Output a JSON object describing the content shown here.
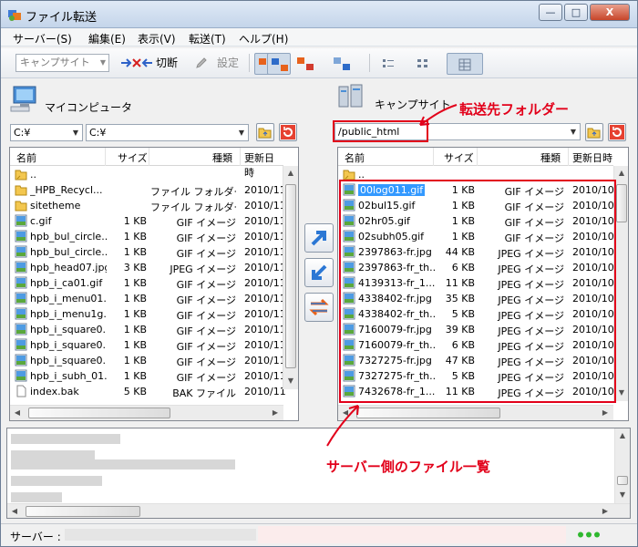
{
  "window": {
    "title": "ファイル転送"
  },
  "title_buttons": {
    "minimize": "—",
    "maximize": "□",
    "close": "X"
  },
  "menu": [
    "サーバー(S)",
    "編集(E)",
    "表示(V)",
    "転送(T)",
    "ヘルプ(H)"
  ],
  "toolbar": {
    "site_select": "キャンプサイト",
    "disconnect_label": "切断",
    "settings_label": "設定",
    "mode_icons": [
      "upload-ascii-icon",
      "upload-binary-icon",
      "download-ascii-icon",
      "download-binary-icon",
      "view-list-icon",
      "view-small-icons-icon",
      "view-details-icon"
    ]
  },
  "left_pane": {
    "title": "マイコンピュータ",
    "drive": "C:¥",
    "path": "C:¥",
    "columns": [
      "名前",
      "サイズ",
      "種類",
      "更新日時"
    ],
    "rows": [
      {
        "icon": "folder-up-icon",
        "name": "..",
        "size": "",
        "type": "",
        "date": ""
      },
      {
        "icon": "folder-icon",
        "name": "_HPB_Recycl...",
        "size": "",
        "type": "ファイル フォルダー",
        "date": "2010/11"
      },
      {
        "icon": "folder-icon",
        "name": "sitetheme",
        "size": "",
        "type": "ファイル フォルダー",
        "date": "2010/11"
      },
      {
        "icon": "image-icon",
        "name": "c.gif",
        "size": "1 KB",
        "type": "GIF イメージ",
        "date": "2010/11"
      },
      {
        "icon": "image-icon",
        "name": "hpb_bul_circle...",
        "size": "1 KB",
        "type": "GIF イメージ",
        "date": "2010/11"
      },
      {
        "icon": "image-icon",
        "name": "hpb_bul_circle...",
        "size": "1 KB",
        "type": "GIF イメージ",
        "date": "2010/11"
      },
      {
        "icon": "image-icon",
        "name": "hpb_head07.jpg",
        "size": "3 KB",
        "type": "JPEG イメージ",
        "date": "2010/11"
      },
      {
        "icon": "image-icon",
        "name": "hpb_i_ca01.gif",
        "size": "1 KB",
        "type": "GIF イメージ",
        "date": "2010/11"
      },
      {
        "icon": "image-icon",
        "name": "hpb_i_menu01...",
        "size": "1 KB",
        "type": "GIF イメージ",
        "date": "2010/11"
      },
      {
        "icon": "image-icon",
        "name": "hpb_i_menu1g...",
        "size": "1 KB",
        "type": "GIF イメージ",
        "date": "2010/11"
      },
      {
        "icon": "image-icon",
        "name": "hpb_i_square0...",
        "size": "1 KB",
        "type": "GIF イメージ",
        "date": "2010/11"
      },
      {
        "icon": "image-icon",
        "name": "hpb_i_square0...",
        "size": "1 KB",
        "type": "GIF イメージ",
        "date": "2010/11"
      },
      {
        "icon": "image-icon",
        "name": "hpb_i_square0...",
        "size": "1 KB",
        "type": "GIF イメージ",
        "date": "2010/11"
      },
      {
        "icon": "image-icon",
        "name": "hpb_i_subh_01...",
        "size": "1 KB",
        "type": "GIF イメージ",
        "date": "2010/11"
      },
      {
        "icon": "file-icon",
        "name": "index.bak",
        "size": "5 KB",
        "type": "BAK ファイル",
        "date": "2010/11"
      }
    ]
  },
  "right_pane": {
    "title": "キャンプサイト",
    "path": "/public_html",
    "columns": [
      "名前",
      "サイズ",
      "種類",
      "更新日時"
    ],
    "rows": [
      {
        "icon": "folder-up-icon",
        "name": "..",
        "size": "",
        "type": "",
        "date": ""
      },
      {
        "icon": "image-icon",
        "name": "00log011.gif",
        "size": "1 KB",
        "type": "GIF イメージ",
        "date": "2010/10",
        "selected": true
      },
      {
        "icon": "image-icon",
        "name": "02bul15.gif",
        "size": "1 KB",
        "type": "GIF イメージ",
        "date": "2010/10"
      },
      {
        "icon": "image-icon",
        "name": "02hr05.gif",
        "size": "1 KB",
        "type": "GIF イメージ",
        "date": "2010/10"
      },
      {
        "icon": "image-icon",
        "name": "02subh05.gif",
        "size": "1 KB",
        "type": "GIF イメージ",
        "date": "2010/10"
      },
      {
        "icon": "image-icon",
        "name": "2397863-fr.jpg",
        "size": "44 KB",
        "type": "JPEG イメージ",
        "date": "2010/10"
      },
      {
        "icon": "image-icon",
        "name": "2397863-fr_th...",
        "size": "6 KB",
        "type": "JPEG イメージ",
        "date": "2010/10"
      },
      {
        "icon": "image-icon",
        "name": "4139313-fr_1...",
        "size": "11 KB",
        "type": "JPEG イメージ",
        "date": "2010/10"
      },
      {
        "icon": "image-icon",
        "name": "4338402-fr.jpg",
        "size": "35 KB",
        "type": "JPEG イメージ",
        "date": "2010/10"
      },
      {
        "icon": "image-icon",
        "name": "4338402-fr_th...",
        "size": "5 KB",
        "type": "JPEG イメージ",
        "date": "2010/10"
      },
      {
        "icon": "image-icon",
        "name": "7160079-fr.jpg",
        "size": "39 KB",
        "type": "JPEG イメージ",
        "date": "2010/10"
      },
      {
        "icon": "image-icon",
        "name": "7160079-fr_th...",
        "size": "6 KB",
        "type": "JPEG イメージ",
        "date": "2010/10"
      },
      {
        "icon": "image-icon",
        "name": "7327275-fr.jpg",
        "size": "47 KB",
        "type": "JPEG イメージ",
        "date": "2010/10"
      },
      {
        "icon": "image-icon",
        "name": "7327275-fr_th...",
        "size": "5 KB",
        "type": "JPEG イメージ",
        "date": "2010/10"
      },
      {
        "icon": "image-icon",
        "name": "7432678-fr_1...",
        "size": "11 KB",
        "type": "JPEG イメージ",
        "date": "2010/10"
      }
    ]
  },
  "transfer_buttons": [
    "upload-arrow-icon",
    "download-arrow-icon",
    "sync-arrows-icon"
  ],
  "status": {
    "label": "サーバー :"
  },
  "annotations": {
    "destination_folder": "転送先フォルダー",
    "server_file_list": "サーバー側のファイル一覧"
  },
  "colors": {
    "annotation_red": "#e2001a",
    "selection_blue": "#3399ff",
    "title_blue": "#c4d5ea"
  }
}
